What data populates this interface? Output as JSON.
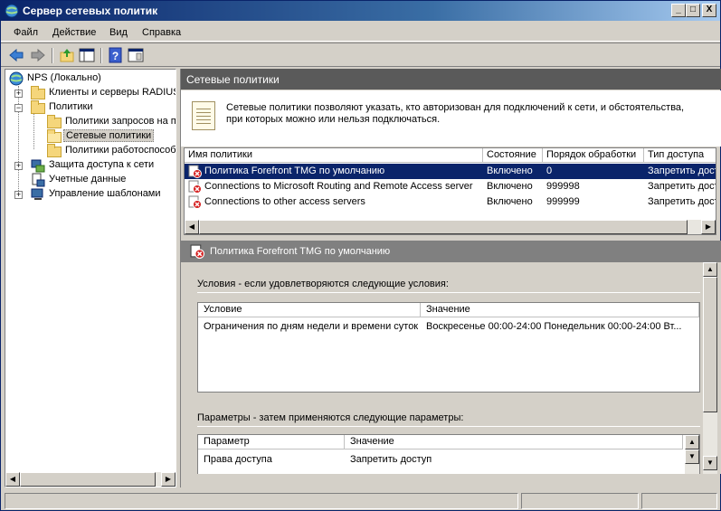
{
  "window": {
    "title": "Сервер сетевых политик",
    "controls": {
      "minimize": "_",
      "maximize": "□",
      "close": "X"
    }
  },
  "menu": {
    "file": "Файл",
    "action": "Действие",
    "view": "Вид",
    "help": "Справка"
  },
  "toolbar": {
    "icons": [
      "back-arrow-icon",
      "forward-arrow-icon",
      "up-folder-icon",
      "show-hide-tree-icon",
      "help-icon",
      "properties-icon"
    ]
  },
  "tree": {
    "root": "NPS (Локально)",
    "items": [
      {
        "label": "Клиенты и серверы RADIUS",
        "expander": "+"
      },
      {
        "label": "Политики",
        "expander": "−"
      },
      {
        "label": "Политики запросов на по"
      },
      {
        "label": "Сетевые политики"
      },
      {
        "label": "Политики работоспособн"
      },
      {
        "label": "Защита доступа к сети",
        "expander": "+"
      },
      {
        "label": "Учетные данные"
      },
      {
        "label": "Управление шаблонами",
        "expander": "+"
      }
    ]
  },
  "content": {
    "header": "Сетевые политики",
    "info_line1": "Сетевые политики позволяют указать, кто авторизован для подключений к сети, и обстоятельства,",
    "info_line2": "при которых можно или нельзя подключаться.",
    "columns": [
      "Имя политики",
      "Состояние",
      "Порядок обработки",
      "Тип доступа"
    ],
    "rows": [
      {
        "name": "Политика Forefront TMG по умолчанию",
        "state": "Включено",
        "order": "0",
        "access": "Запретить досту"
      },
      {
        "name": "Connections to Microsoft Routing and Remote Access server",
        "state": "Включено",
        "order": "999998",
        "access": "Запретить досту"
      },
      {
        "name": "Connections to other access servers",
        "state": "Включено",
        "order": "999999",
        "access": "Запретить досту"
      }
    ]
  },
  "detail": {
    "title": "Политика Forefront TMG по умолчанию",
    "conditions_title": "Условия - если удовлетворяются следующие условия:",
    "conditions_columns": [
      "Условие",
      "Значение"
    ],
    "conditions_rows": [
      {
        "condition": "Ограничения по дням недели и времени суток",
        "value": "Воскресенье 00:00-24:00 Понедельник 00:00-24:00 Вт..."
      }
    ],
    "params_title": "Параметры - затем применяются следующие параметры:",
    "params_columns": [
      "Параметр",
      "Значение"
    ],
    "params_rows": [
      {
        "param": "Права доступа",
        "value": "Запретить доступ"
      }
    ]
  },
  "colors": {
    "selection": "#0a246a",
    "panel_header": "#5a5a5a",
    "detail_header": "#808080"
  }
}
